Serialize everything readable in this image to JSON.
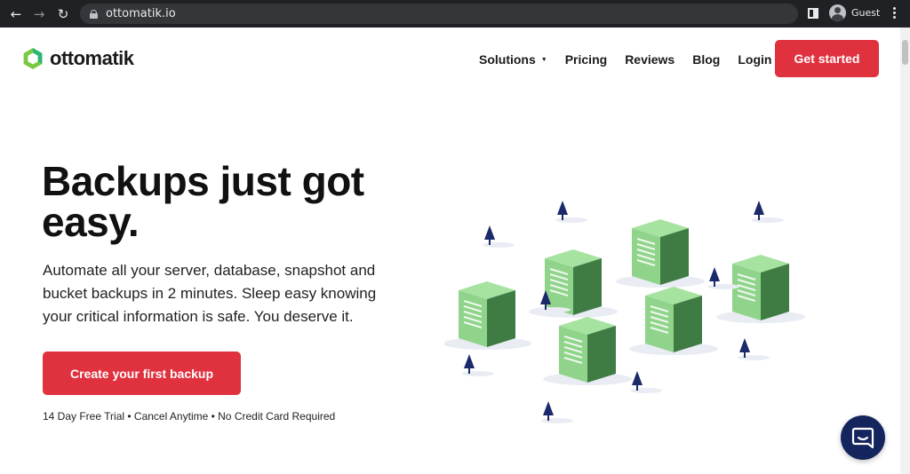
{
  "browser": {
    "url": "ottomatik.io",
    "profile_label": "Guest",
    "icons": [
      "back-arrow-icon",
      "forward-arrow-icon",
      "reload-icon",
      "lock-icon",
      "side-panel-icon",
      "profile-icon",
      "menu-dots-icon"
    ]
  },
  "header": {
    "logo_text": "ottomatik",
    "nav": [
      {
        "label": "Solutions",
        "has_dropdown": true
      },
      {
        "label": "Pricing"
      },
      {
        "label": "Reviews"
      },
      {
        "label": "Blog"
      },
      {
        "label": "Login"
      }
    ],
    "cta_label": "Get started"
  },
  "hero": {
    "title_line1": "Backups just got",
    "title_line2": "easy.",
    "subtitle": "Automate all your server, database, snapshot and bucket backups in 2 minutes. Sleep easy knowing your critical information is safe. You deserve it.",
    "cta_label": "Create your first backup",
    "trial_note": "14 Day Free Trial • Cancel Anytime • No Credit Card Required"
  },
  "colors": {
    "brand_red": "#e0313e",
    "chrome_bg": "#202124",
    "server_light": "#8fd48a",
    "server_dark": "#3f7c44",
    "tree_navy": "#1b2a6b",
    "chat_navy": "#14245c"
  },
  "chat": {
    "icon": "chat-bubble-icon"
  }
}
